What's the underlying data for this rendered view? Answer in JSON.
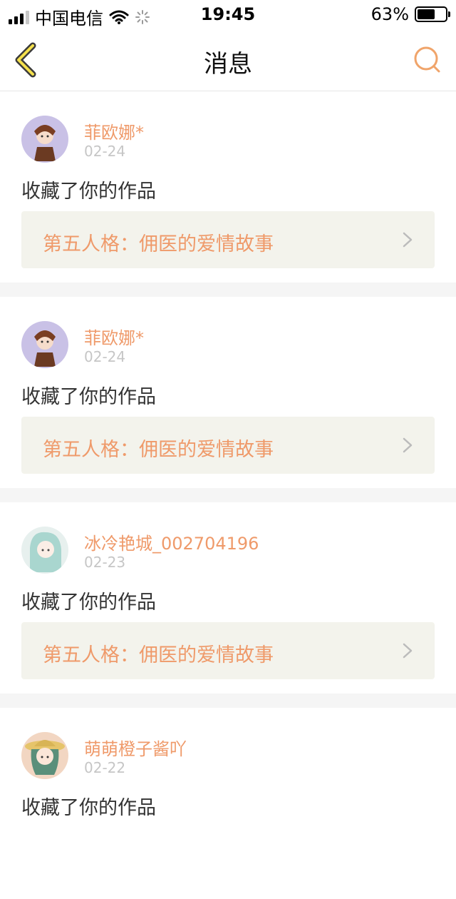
{
  "status_bar": {
    "carrier": "中国电信",
    "time": "19:45",
    "battery_percent": "63%",
    "battery_level": 0.63
  },
  "nav": {
    "title": "消息",
    "back_icon": "chevron-left-icon",
    "search_icon": "search-icon",
    "accent_color": "#f0a46a"
  },
  "messages": [
    {
      "user": "菲欧娜*",
      "date": "02-24",
      "action": "收藏了你的作品",
      "work_title": "第五人格：佣医的爱情故事",
      "avatar": "avatar-brown-hood"
    },
    {
      "user": "菲欧娜*",
      "date": "02-24",
      "action": "收藏了你的作品",
      "work_title": "第五人格：佣医的爱情故事",
      "avatar": "avatar-brown-hood"
    },
    {
      "user": "冰冷艳城_002704196",
      "date": "02-23",
      "action": "收藏了你的作品",
      "work_title": "第五人格：佣医的爱情故事",
      "avatar": "avatar-teal-hair"
    },
    {
      "user": "萌萌橙子酱吖",
      "date": "02-22",
      "action": "收藏了你的作品",
      "work_title": "",
      "avatar": "avatar-straw-hat"
    }
  ]
}
